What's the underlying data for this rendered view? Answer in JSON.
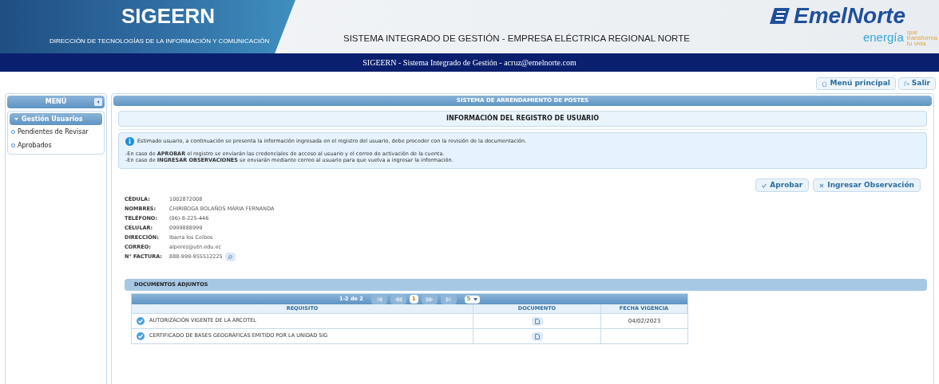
{
  "header": {
    "app_name": "SIGEERN",
    "department": "DIRECCIÓN DE TECNOLOGÍAS DE LA INFORMACIÓN Y COMUNICACIÓN",
    "system_title": "SISTEMA INTEGRADO DE GESTIÓN - EMPRESA ELÉCTRICA REGIONAL NORTE",
    "logo_text": "EmelNorte",
    "slogan_1": "energía",
    "slogan_2": "que",
    "slogan_3": "transforma",
    "slogan_4": "tu vida"
  },
  "user_bar": "SIGEERN - Sistema Integrado de Gestión - acruz@emelnorte.com",
  "top_buttons": [
    "Menú principal",
    "Salir"
  ],
  "sidebar": {
    "title": "MENÚ",
    "items": [
      {
        "label": "Gestión Usuarios",
        "expanded": true,
        "children": [
          {
            "label": "Pendientes de Revisar"
          },
          {
            "label": "Aprobados"
          }
        ]
      }
    ]
  },
  "main": {
    "title": "SISTEMA DE ARRENDAMIENTO DE POSTES",
    "section_title": "INFORMACIÓN DEL REGISTRO DE USUARIO",
    "info": {
      "intro": "Estimado usuario, a continuación se presenta la información ingresada en el registro del usuario, debe proceder con la revisión de la documentación.",
      "lines": [
        "-En caso de **APROBAR** el registro se enviarán las credenciales de acceso al usuario y el correo de activación de la cuenta.",
        "-En caso de **INGRESAR OBSERVACIONES** se enviarán mediante correo al usuario para que vuelva a ingresar la información."
      ]
    },
    "actions": [
      {
        "kind": "approve",
        "label": "Aprobar"
      },
      {
        "kind": "observe",
        "label": "Ingresar Observación"
      }
    ],
    "fields": [
      {
        "label": "CÉDULA:",
        "value": "1002872008"
      },
      {
        "label": "NOMBRES:",
        "value": "CHIRIBOGA BOLAÑOS MARIA FERNANDA"
      },
      {
        "label": "TELÉFONO:",
        "value": "(06)-8-225-446"
      },
      {
        "label": "CELULAR:",
        "value": "0999888999"
      },
      {
        "label": "DIRECCIÓN:",
        "value": "Ibarra los Ceibos"
      },
      {
        "label": "CORREO:",
        "value": "alperez@utn.edu.ec"
      },
      {
        "label": "N° FACTURA:",
        "value": "888-999-955512225",
        "search": true
      }
    ],
    "documents": {
      "title": "DOCUMENTOS ADJUNTOS",
      "paginator": {
        "summary": "1-2 de 2",
        "page": "1",
        "page_size": "5"
      },
      "columns": [
        "REQUISITO",
        "DOCUMENTO",
        "FECHA VIGENCIA"
      ],
      "rows": [
        {
          "checked": true,
          "requisito": "AUTORIZACIÓN VIGENTE DE LA ARCOTEL",
          "fecha": "04/02/2023"
        },
        {
          "checked": true,
          "requisito": "CERTIFICADO DE BASES GEOGRÁFICAS EMITIDO POR LA UNIDAD SIG"
        }
      ]
    }
  }
}
